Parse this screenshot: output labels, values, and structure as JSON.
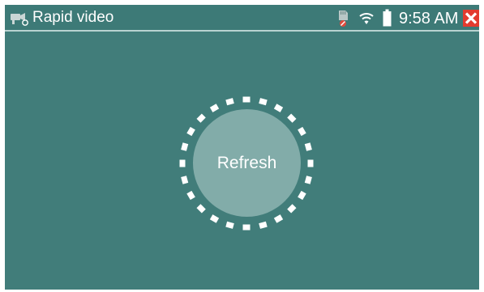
{
  "statusbar": {
    "title": "Rapid video",
    "time": "9:58 AM",
    "app_icon": "camera-record-icon",
    "sd_icon": "sd-card-error-icon",
    "wifi_icon": "wifi-icon",
    "battery_icon": "battery-icon",
    "close_icon": "close-icon"
  },
  "main": {
    "refresh_label": "Refresh",
    "spinner_icon": "loading-ring-icon"
  },
  "colors": {
    "background": "#417d7a",
    "button": "#82aca9",
    "close": "#e33b2f",
    "text": "#ffffff"
  }
}
